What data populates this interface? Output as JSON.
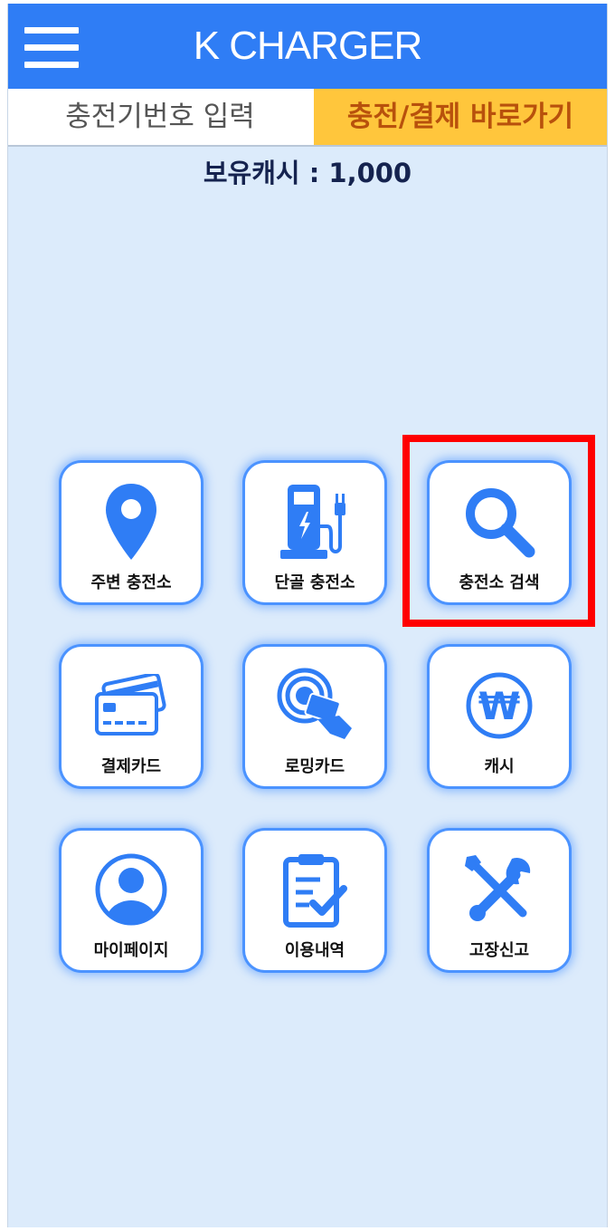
{
  "header": {
    "title": "K CHARGER"
  },
  "tabs": {
    "input_label": "충전기번호 입력",
    "quick_label": "충전/결제 바로가기"
  },
  "cash": {
    "text": "보유캐시 : 1,000"
  },
  "menu": [
    {
      "label": "주변 충전소",
      "icon": "location-pin-icon"
    },
    {
      "label": "단골 충전소",
      "icon": "charging-station-icon"
    },
    {
      "label": "충전소 검색",
      "icon": "search-icon"
    },
    {
      "label": "결제카드",
      "icon": "credit-card-icon"
    },
    {
      "label": "로밍카드",
      "icon": "rfid-card-icon"
    },
    {
      "label": "캐시",
      "icon": "won-icon"
    },
    {
      "label": "마이페이지",
      "icon": "user-icon"
    },
    {
      "label": "이용내역",
      "icon": "clipboard-check-icon"
    },
    {
      "label": "고장신고",
      "icon": "tools-icon"
    }
  ],
  "colors": {
    "header": "#2f7df5",
    "quick_tab": "#ffc63c",
    "background": "#dcebfb",
    "icon_blue": "#2f7df5",
    "highlight": "#ff0000"
  }
}
